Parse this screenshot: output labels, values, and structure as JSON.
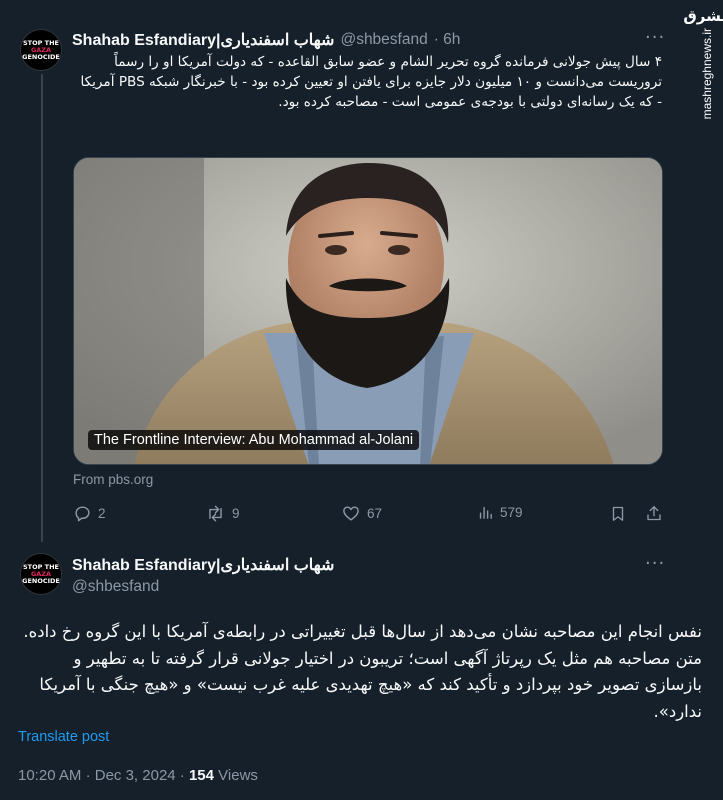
{
  "watermark": {
    "logo": "مشرق",
    "url": "mashreghnews.ir"
  },
  "tweet1": {
    "name": "Shahab Esfandiary|شهاب اسفندیاری",
    "handle": "@shbesfand",
    "time": "· 6h",
    "text": "۴ سال پیش جولانی فرمانده گروه تحریر الشام و عضو سابق القاعده - که دولت آمریکا او را رسماً تروریست می‌دانست و ۱۰ میلیون دلار جایزه برای یافتن او تعیین کرده بود - با خبرنگار شبکه PBS آمریکا - که یک رسانه‌ای دولتی با بودجه‌ی عمومی است - مصاحبه کرده بود.",
    "media_caption": "The Frontline Interview: Abu Mohammad al-Jolani",
    "source": "From pbs.org",
    "replies": "2",
    "reposts": "9",
    "likes": "67",
    "views": "579"
  },
  "tweet2": {
    "name": "Shahab Esfandiary|شهاب اسفندیاری",
    "handle": "@shbesfand",
    "text": "نفس انجام این مصاحبه نشان می‌دهد از سال‌ها قبل تغییراتی در رابطه‌ی آمریکا با این گروه رخ داده. متن مصاحبه هم مثل یک رپرتاژ آگهی است؛ تریبون در اختیار جولانی قرار گرفته تا به تطهیر و بازسازی تصویر خود بپردازد و تأکید کند که «هیچ تهدیدی علیه غرب نیست» و «هیچ جنگی با آمریکا ندارد».",
    "translate": "Translate post",
    "time": "10:20 AM",
    "date": "Dec 3, 2024",
    "views": "154",
    "views_label": "Views"
  },
  "avatar": {
    "line1": "STOP THE",
    "line2": "GAZA",
    "line3": "GENOCIDE"
  },
  "colors": {
    "background": "#15202b",
    "accent": "#1d9bf0",
    "muted": "#8b98a5"
  }
}
